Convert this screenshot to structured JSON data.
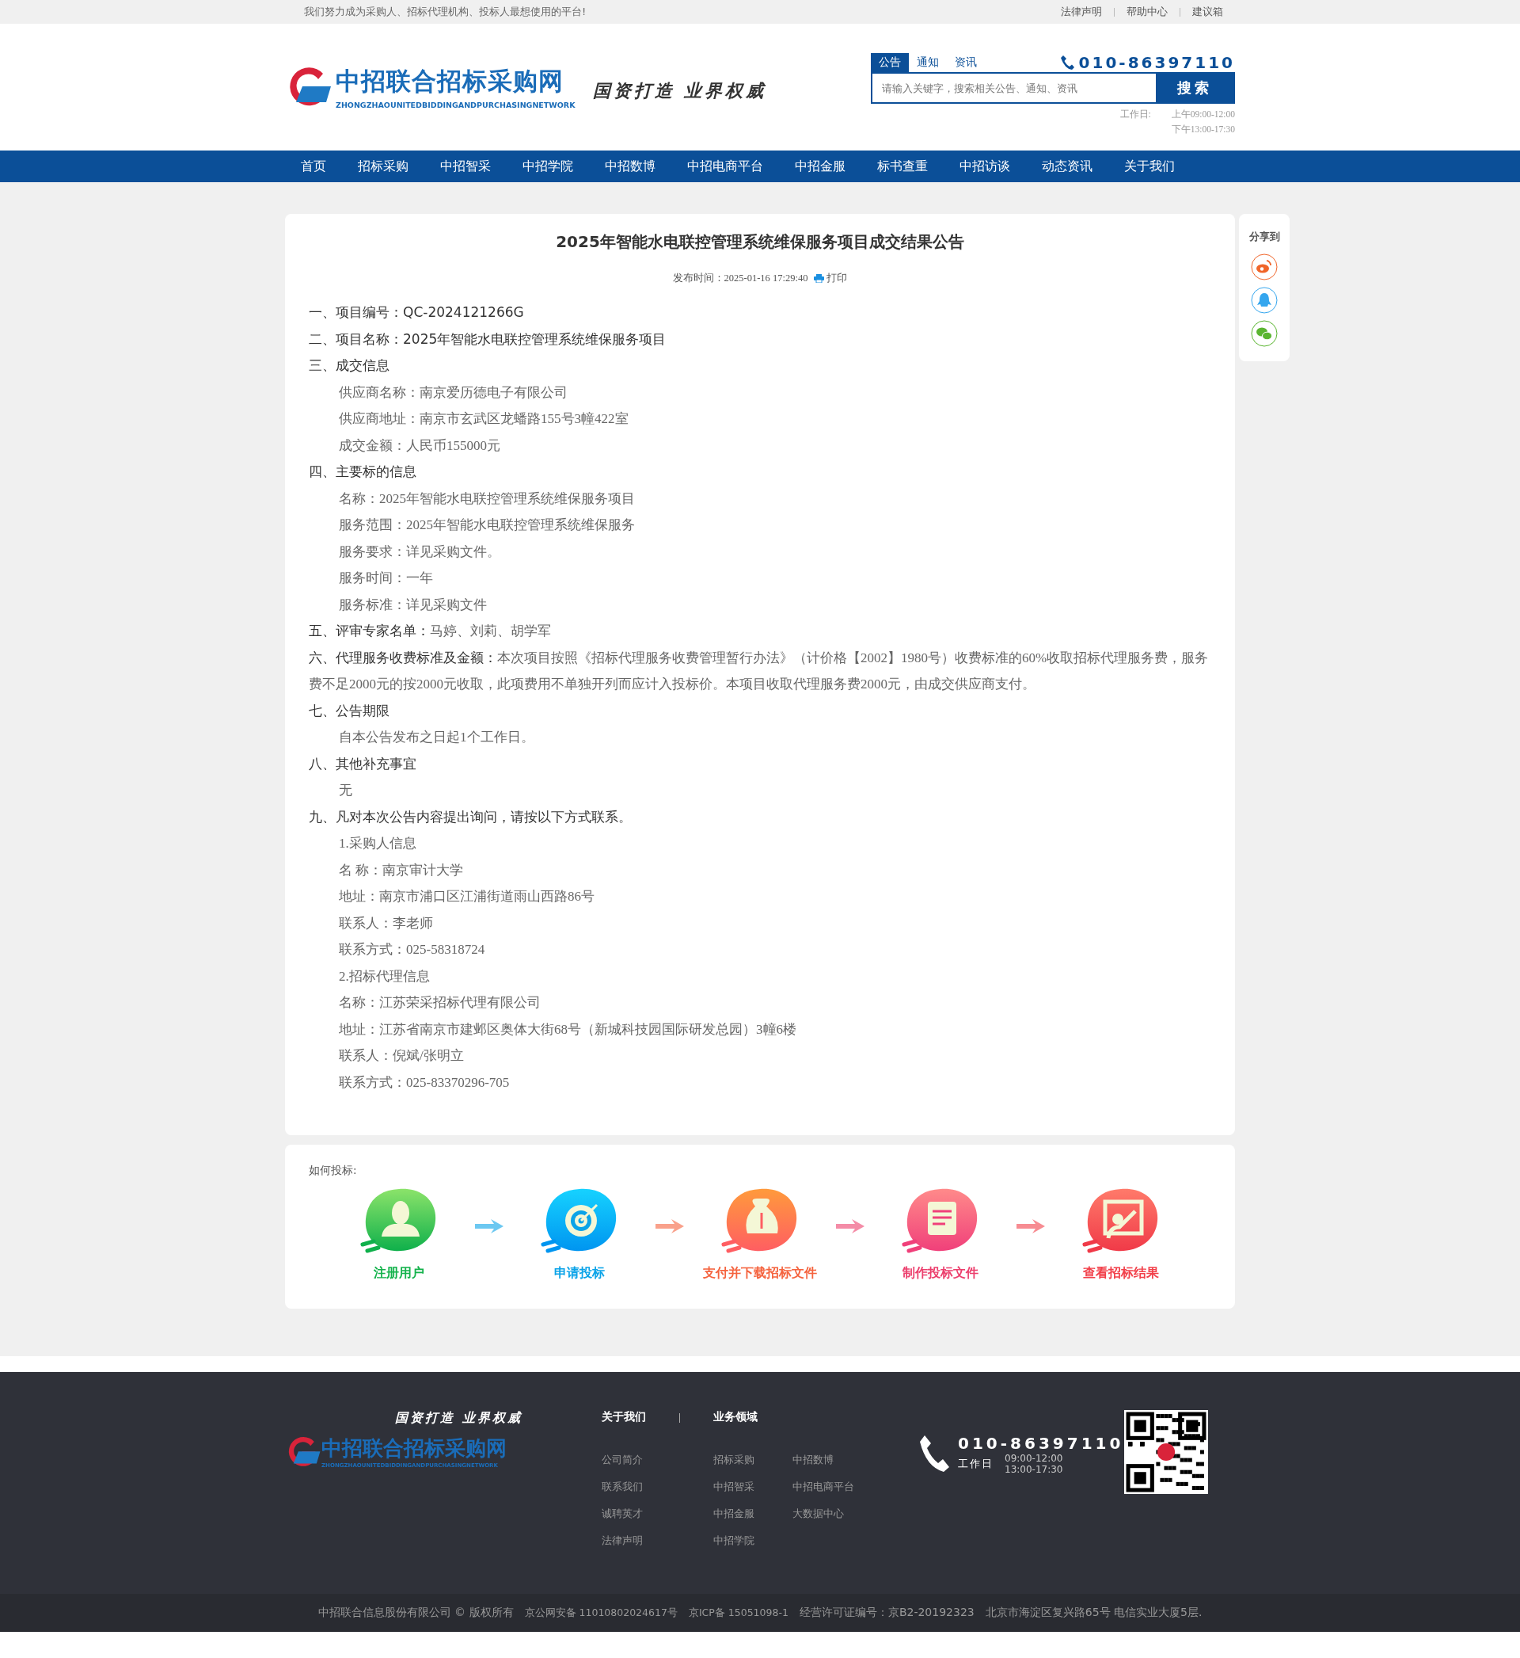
{
  "top_bar": {
    "slogan": "我们努力成为采购人、招标代理机构、投标人最想使用的平台!",
    "links": [
      "法律声明",
      "帮助中心",
      "建议箱"
    ]
  },
  "header": {
    "logo_title": "中招联合招标采购网",
    "logo_subtitle": "ZHONGZHAOUNITEDBIDDINGANDPURCHASINGNETWORK",
    "motto": "国资打造 业界权威",
    "search_tabs": [
      {
        "label": "公告",
        "selected": true
      },
      {
        "label": "通知",
        "selected": false
      },
      {
        "label": "资讯",
        "selected": false
      }
    ],
    "search": {
      "placeholder": "请输入关键字，搜索相关公告、通知、资讯",
      "button": "搜索"
    },
    "phone": "010-86397110",
    "hours_label": "工作日:",
    "hours": [
      "上午09:00-12:00",
      "下午13:00-17:30"
    ]
  },
  "nav": [
    "首页",
    "招标采购",
    "中招智采",
    "中招学院",
    "中招数博",
    "中招电商平台",
    "中招金服",
    "标书查重",
    "中招访谈",
    "动态资讯",
    "关于我们"
  ],
  "article": {
    "title": "2025年智能水电联控管理系统维保服务项目成交结果公告",
    "published_label": "发布时间：",
    "published": "2025-01-16 17:29:40",
    "print": "打印",
    "lines": [
      {
        "kind": "heading",
        "label": "一、项目编号：QC-2024121266G"
      },
      {
        "kind": "heading",
        "label": "二、项目名称：2025年智能水电联控管理系统维保服务项目"
      },
      {
        "kind": "heading",
        "label": "三、成交信息"
      },
      {
        "kind": "detail",
        "text": "供应商名称：南京爱历德电子有限公司"
      },
      {
        "kind": "detail",
        "text": "供应商地址：南京市玄武区龙蟠路155号3幢422室"
      },
      {
        "kind": "detail",
        "text": "成交金额：人民币155000元"
      },
      {
        "kind": "heading",
        "label": "四、主要标的信息"
      },
      {
        "kind": "detail",
        "text": "名称：2025年智能水电联控管理系统维保服务项目"
      },
      {
        "kind": "detail",
        "text": "服务范围：2025年智能水电联控管理系统维保服务"
      },
      {
        "kind": "detail",
        "text": "服务要求：详见采购文件。"
      },
      {
        "kind": "detail",
        "text": "服务时间：一年"
      },
      {
        "kind": "detail",
        "text": "服务标准：详见采购文件"
      },
      {
        "kind": "heading",
        "label": "五、评审专家名单：",
        "value": "马婷、刘莉、胡学军"
      },
      {
        "kind": "heading",
        "label": "六、代理服务收费标准及金额：",
        "value": "本次项目按照《招标代理服务收费管理暂行办法》（计价格【2002】1980号）收费标准的60%收取招标代理服务费，服务费不足2000元的按2000元收取，此项费用不单独开列而应计入投标价。本项目收取代理服务费2000元，由成交供应商支付。"
      },
      {
        "kind": "heading",
        "label": "七、公告期限"
      },
      {
        "kind": "detail",
        "text": "自本公告发布之日起1个工作日。"
      },
      {
        "kind": "heading",
        "label": "八、其他补充事宜"
      },
      {
        "kind": "detail",
        "text": "无"
      },
      {
        "kind": "heading",
        "label": "九、凡对本次公告内容提出询问，请按以下方式联系。"
      },
      {
        "kind": "detail",
        "text": "1.采购人信息"
      },
      {
        "kind": "detail",
        "text": "名 称：南京审计大学"
      },
      {
        "kind": "detail",
        "text": "地址：南京市浦口区江浦街道雨山西路86号"
      },
      {
        "kind": "detail",
        "text": "联系人：李老师"
      },
      {
        "kind": "detail",
        "text": "联系方式：025-58318724"
      },
      {
        "kind": "detail",
        "text": "2.招标代理信息"
      },
      {
        "kind": "detail",
        "text": "名称：江苏荣采招标代理有限公司"
      },
      {
        "kind": "detail",
        "text": "地址：江苏省南京市建邺区奥体大街68号（新城科技园国际研发总园）3幢6楼"
      },
      {
        "kind": "detail",
        "text": "联系人：倪斌/张明立"
      },
      {
        "kind": "detail",
        "text": "联系方式：025-83370296-705"
      }
    ]
  },
  "share": {
    "label": "分享到",
    "icons": [
      {
        "kind": "weibo"
      },
      {
        "kind": "qq"
      },
      {
        "kind": "wechat"
      }
    ]
  },
  "how_to_bid": {
    "title": "如何投标:",
    "steps": [
      {
        "kind": "user",
        "label": "注册用户",
        "color": "#13b24b"
      },
      {
        "kind": "target",
        "label": "申请投标",
        "color": "#0aa3e8"
      },
      {
        "kind": "bag",
        "label": "支付并下载招标文件",
        "color": "#f5633e"
      },
      {
        "kind": "notepad",
        "label": "制作投标文件",
        "color": "#ec3f6d"
      },
      {
        "kind": "board",
        "label": "查看招标结果",
        "color": "#f2404a"
      }
    ]
  },
  "footer": {
    "motto": "国资打造 业界权威",
    "logo_title": "中招联合招标采购网",
    "logo_subtitle": "ZHONGZHAOUNITEDBIDDINGANDPURCHASINGNETWORK",
    "columns": [
      {
        "title": "关于我们",
        "links": [
          [
            "公司简介",
            "联系我们",
            "诚聘英才",
            "法律声明"
          ]
        ]
      },
      {
        "title": "业务领域",
        "links": [
          [
            "招标采购",
            "中招智采",
            "中招金服",
            "中招学院"
          ],
          [
            "中招数博",
            "中招电商平台",
            "大数据中心"
          ]
        ]
      }
    ],
    "phone": "010-86397110",
    "hours_label": "工作日",
    "hours": [
      "09:00-12:00",
      "13:00-17:30"
    ],
    "copyright": "中招联合信息股份有限公司 © 版权所有",
    "records": [
      "京公网安备 11010802024617号",
      "京ICP备 15051098-1"
    ],
    "license": "经营许可证编号：京B2-20192323",
    "address": "北京市海淀区复兴路65号 电信实业大厦5层."
  }
}
